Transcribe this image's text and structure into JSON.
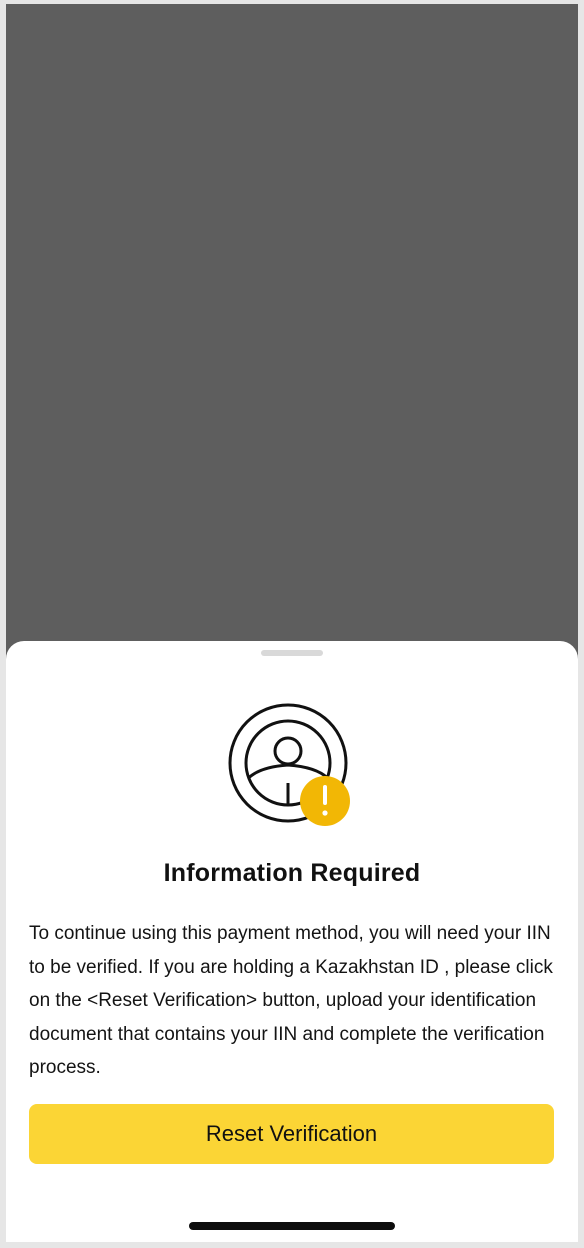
{
  "sheet": {
    "title": "Information Required",
    "message": "To continue using this payment method, you will need your IIN to be verified. If you are holding a Kazakhstan ID , please click on the <Reset Verification> button, upload your identification document that contains your IIN and complete the verification process.",
    "primary_button_label": "Reset Verification"
  },
  "illustration": {
    "icon": "user-verification-warning-icon",
    "badge_symbol": "!"
  },
  "colors": {
    "overlay": "#5e5e5e",
    "accent": "#fbd535",
    "warning_badge": "#f2b705",
    "text": "#111111"
  }
}
